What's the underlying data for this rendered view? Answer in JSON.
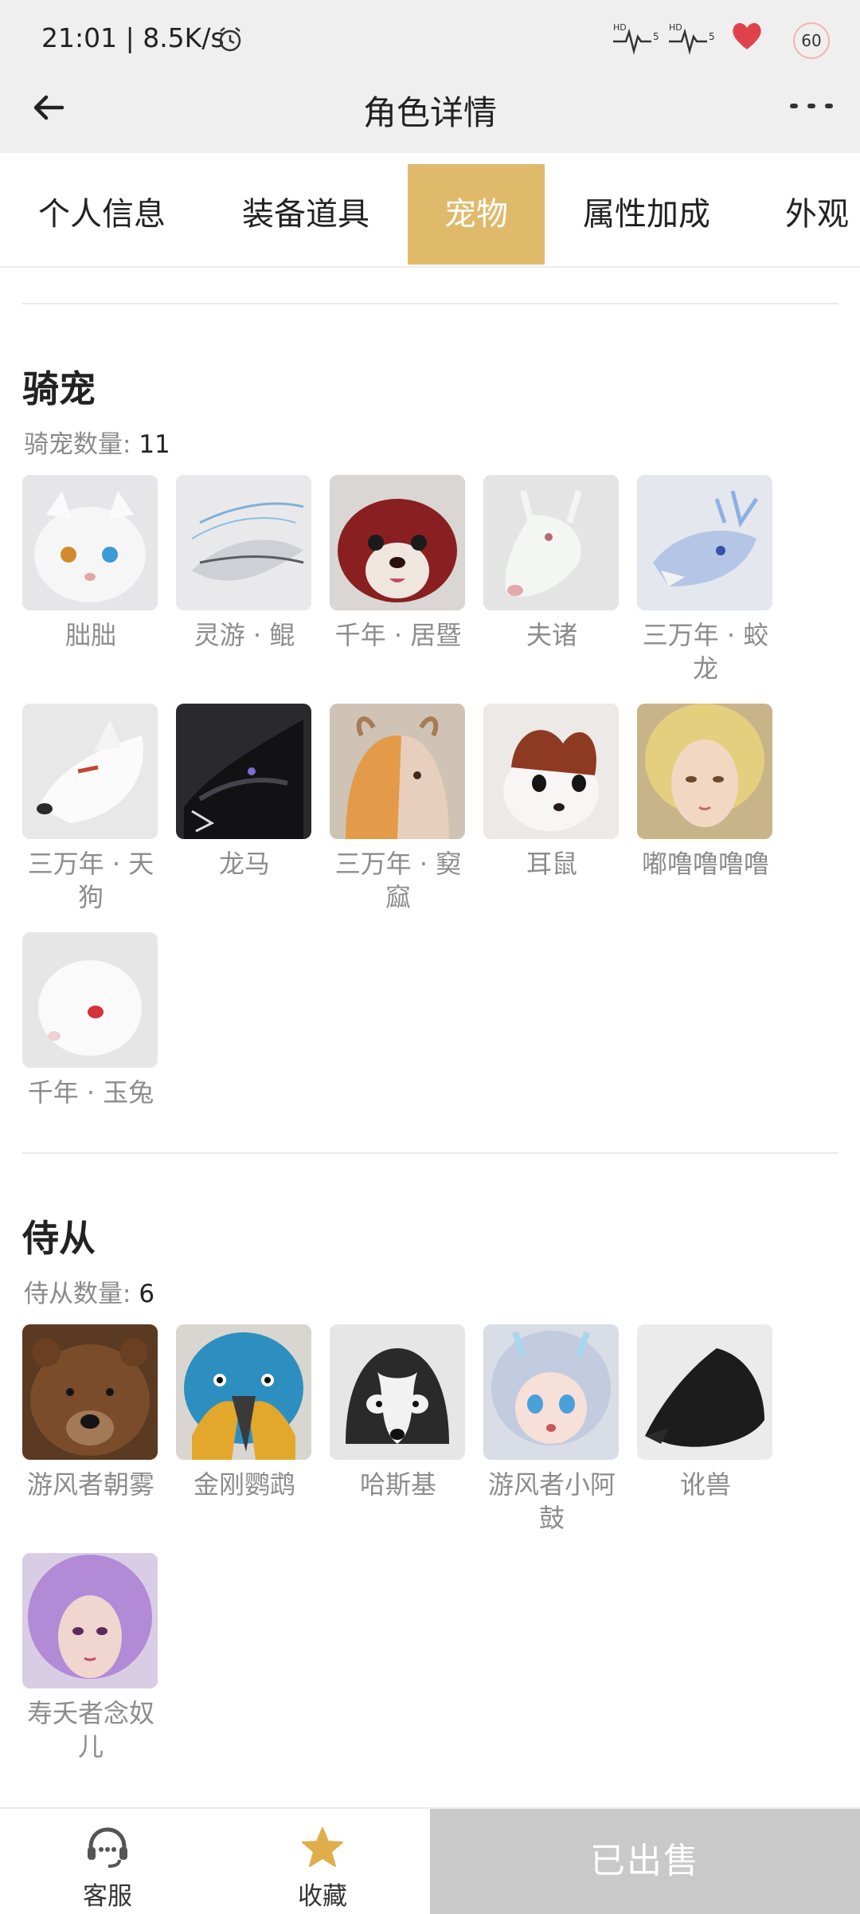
{
  "status_bar": {
    "time": "21:01 | 8.5K/s",
    "battery": "60"
  },
  "header": {
    "title": "角色详情"
  },
  "tabs": [
    {
      "label": "个人信息",
      "active": false
    },
    {
      "label": "装备道具",
      "active": false
    },
    {
      "label": "宠物",
      "active": true
    },
    {
      "label": "属性加成",
      "active": false
    },
    {
      "label": "外观",
      "active": false
    }
  ],
  "mounts": {
    "title": "骑宠",
    "count_label": "骑宠数量:",
    "count": "11",
    "items": [
      {
        "name": "朏朏",
        "icon": "white-cat-portrait"
      },
      {
        "name": "灵游 · 鲲",
        "icon": "spirit-fish-portrait"
      },
      {
        "name": "千年 · 居暨",
        "icon": "red-squirrel-portrait"
      },
      {
        "name": "夫诸",
        "icon": "white-deer-portrait"
      },
      {
        "name": "三万年 · 蛟龙",
        "icon": "ice-dragon-portrait"
      },
      {
        "name": "三万年 · 天狗",
        "icon": "white-wolf-portrait"
      },
      {
        "name": "龙马",
        "icon": "black-dragon-portrait"
      },
      {
        "name": "三万年 · 窫窳",
        "icon": "horned-beast-portrait"
      },
      {
        "name": "耳鼠",
        "icon": "ear-mouse-portrait"
      },
      {
        "name": "嘟噜噜噜噜",
        "icon": "blonde-girl-portrait"
      },
      {
        "name": "千年 · 玉兔",
        "icon": "white-rabbit-portrait"
      }
    ]
  },
  "attendants": {
    "title": "侍从",
    "count_label": "侍从数量:",
    "count": "6",
    "items": [
      {
        "name": "游风者朝雾",
        "icon": "bear-portrait"
      },
      {
        "name": "金刚鹦鹉",
        "icon": "macaw-portrait"
      },
      {
        "name": "哈斯基",
        "icon": "husky-portrait"
      },
      {
        "name": "游风者小阿鼓",
        "icon": "chibi-girl-portrait"
      },
      {
        "name": "讹兽",
        "icon": "shadow-beast-portrait"
      },
      {
        "name": "寿夭者念奴儿",
        "icon": "purple-hair-girl-portrait"
      }
    ]
  },
  "bottom_bar": {
    "service_label": "客服",
    "favorite_label": "收藏",
    "sold_label": "已出售"
  },
  "colors": {
    "accent": "#dfba6b",
    "sold_bg": "#c9c9c9"
  }
}
